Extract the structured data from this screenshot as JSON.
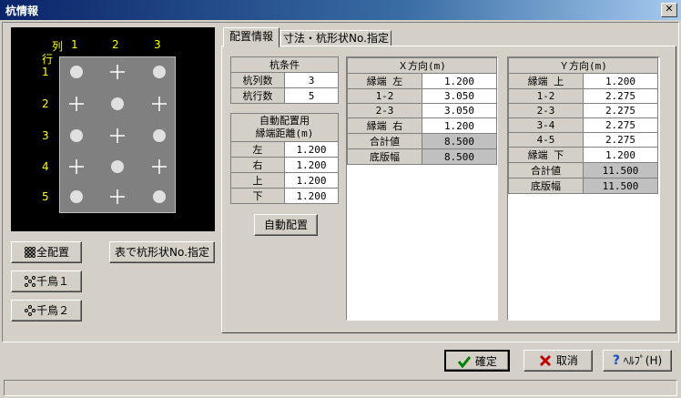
{
  "window": {
    "title": "杭情報",
    "close": "✕"
  },
  "layout_panel": {
    "col_header": "列",
    "row_header": "行",
    "cols": [
      "1",
      "2",
      "3"
    ],
    "rows": [
      "1",
      "2",
      "3",
      "4",
      "5"
    ]
  },
  "left_buttons": {
    "all": "全配置",
    "chidori1": "千鳥１",
    "chidori2": "千鳥２",
    "table_spec": "表で杭形状No.指定"
  },
  "tabs": [
    "配置情報",
    "寸法・杭形状No.指定"
  ],
  "pile_cond": {
    "title": "杭条件",
    "rows": [
      {
        "label": "杭列数",
        "value": "3"
      },
      {
        "label": "杭行数",
        "value": "5"
      }
    ]
  },
  "auto_cond": {
    "title1": "自動配置用",
    "title2": "縁端距離(m)",
    "rows": [
      {
        "label": "左",
        "value": "1.200"
      },
      {
        "label": "右",
        "value": "1.200"
      },
      {
        "label": "上",
        "value": "1.200"
      },
      {
        "label": "下",
        "value": "1.200"
      }
    ]
  },
  "auto_button": "自動配置",
  "x_dir": {
    "title": "Ｘ方向(m)",
    "rows": [
      {
        "label": "縁端 左",
        "value": "1.200",
        "gray": false
      },
      {
        "label": "1-2",
        "value": "3.050",
        "gray": false
      },
      {
        "label": "2-3",
        "value": "3.050",
        "gray": false
      },
      {
        "label": "縁端 右",
        "value": "1.200",
        "gray": false
      },
      {
        "label": "合計値",
        "value": "8.500",
        "gray": true
      },
      {
        "label": "底版幅",
        "value": "8.500",
        "gray": true
      }
    ]
  },
  "y_dir": {
    "title": "Ｙ方向(m)",
    "rows": [
      {
        "label": "縁端 上",
        "value": "1.200",
        "gray": false
      },
      {
        "label": "1-2",
        "value": "2.275",
        "gray": false
      },
      {
        "label": "2-3",
        "value": "2.275",
        "gray": false
      },
      {
        "label": "3-4",
        "value": "2.275",
        "gray": false
      },
      {
        "label": "4-5",
        "value": "2.275",
        "gray": false
      },
      {
        "label": "縁端 下",
        "value": "1.200",
        "gray": false
      },
      {
        "label": "合計値",
        "value": "11.500",
        "gray": true
      },
      {
        "label": "底版幅",
        "value": "11.500",
        "gray": true
      }
    ]
  },
  "footer": {
    "ok": "確定",
    "cancel": "取消",
    "help": "ﾍﾙﾌﾟ(H)"
  },
  "icons": {
    "check": "check-icon",
    "x": "x-icon",
    "help": "question-icon"
  }
}
